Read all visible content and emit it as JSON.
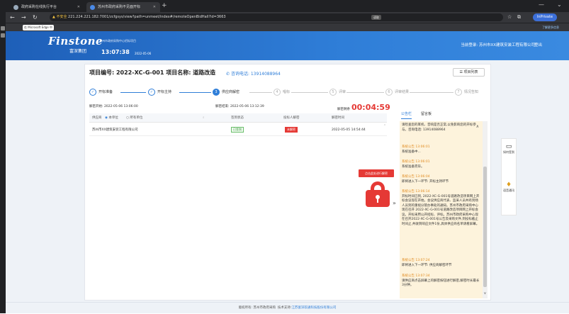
{
  "browser": {
    "tabs": [
      {
        "title": "政府采购在线执行平台",
        "active": false
      },
      {
        "title": "苏州市政府采购不见面开标",
        "active": true
      }
    ],
    "url_insecure_label": "不安全",
    "url": "221.224.221.182:7001/zcfgsys/view?path=unmeet/index#/remoteOpenBidHall?id=3663",
    "url_mid_chip": "读取",
    "profile_label": "InPrivate",
    "fav_item": "在 Microsoft Edge 中打开",
    "fav_right": "了解更多信息"
  },
  "header": {
    "logo": "Finstone",
    "logo_sub": "富深集团",
    "sub_label": "苏州市政府采购中心招标项目",
    "clock": "13:07:38",
    "date": "2022-05-06",
    "user": "当前登录: 苏州市XX建筑安装工程有限公司",
    "logout": "登出"
  },
  "project": {
    "title": "项目编号: 2022-XC-G-001 项目名称: 道路改造",
    "phone": "咨询电话: 13914088964",
    "list_button": "项目列表"
  },
  "steps": [
    {
      "label": "开标准备",
      "state": "done"
    },
    {
      "label": "开标主持",
      "state": "done"
    },
    {
      "label": "供应商解密",
      "state": "current",
      "num": "3"
    },
    {
      "label": "唱标",
      "state": "todo",
      "num": "4"
    },
    {
      "label": "评审",
      "state": "todo",
      "num": "5"
    },
    {
      "label": "评审结果",
      "state": "todo",
      "num": "6"
    },
    {
      "label": "情况告知",
      "state": "todo",
      "num": "7"
    }
  ],
  "timing": {
    "start": "解密开始: 2022-05-06 13:06:00",
    "end": "解密结束: 2022-05-06 13:12:39",
    "left_label": "解密剩余",
    "countdown": "00:04:59"
  },
  "table": {
    "filter_label": "供应商",
    "filter_opt1": "本单位",
    "filter_opt2": "所有单位",
    "col_status": "签到状态",
    "col_bid": "投标人解密",
    "col_time": "解密时间",
    "rows": [
      {
        "supplier": "苏州市XX建筑安装工程有限公司",
        "status": "已签到",
        "decrypt": "未解密",
        "time": "2022-05-05 14:54:44"
      }
    ]
  },
  "decrypt_button": "点击此处进行解密",
  "notice": {
    "tab1": "公告栏",
    "tab2": "留言板",
    "top_text": "请检查您的耳机、音响是否正常,以免影响您的开标参与。咨询电话: 13914088964",
    "entries": [
      {
        "head": "系统公告 13:06:01",
        "body": "系统准备中..."
      },
      {
        "head": "系统公告 13:06:01",
        "body": "系统准备完毕。"
      },
      {
        "head": "系统公告 13:06:04",
        "body": "即将进入下一环节: 开标主持环节"
      },
      {
        "head": "系统公告 13:06:14",
        "body": "开标时间已到, 2022-XC-G-001号道路改造项目网上开标会议现在开始。会议供应商代表、监采人员共有到场人员到的重视分管办事处的通知。苏州市政府采购中心现在召开 2022-XC-G-001号道路改造项目网上开标会议。开标采用公开招标、评标。苏州市政府采购中心现在召开2022-XC-G-001号公告及采购文件,到投标截止时间止,共收到响应文件1份,具体供应商名单请看屏幕。"
      },
      {
        "head": "系统公告 13:07:24",
        "body": "即将进入下一环节: 供应商解密环节"
      },
      {
        "head": "系统公告 13:07:34",
        "body": "请供应商点击屏幕上的解密按钮进行解密,解密时长最长3分钟。"
      }
    ]
  },
  "float": {
    "item1": "如何签到",
    "item2": "语音通讯"
  },
  "footer": {
    "left": "版权所有: 苏州市政府采购",
    "right_label": "技术支持:",
    "right_link": "江苏富深软通科技股份有限公司"
  },
  "colors": {
    "accent": "#2f7ed8",
    "countdown": "#e53935",
    "notice_bg": "#fdf3dc"
  }
}
